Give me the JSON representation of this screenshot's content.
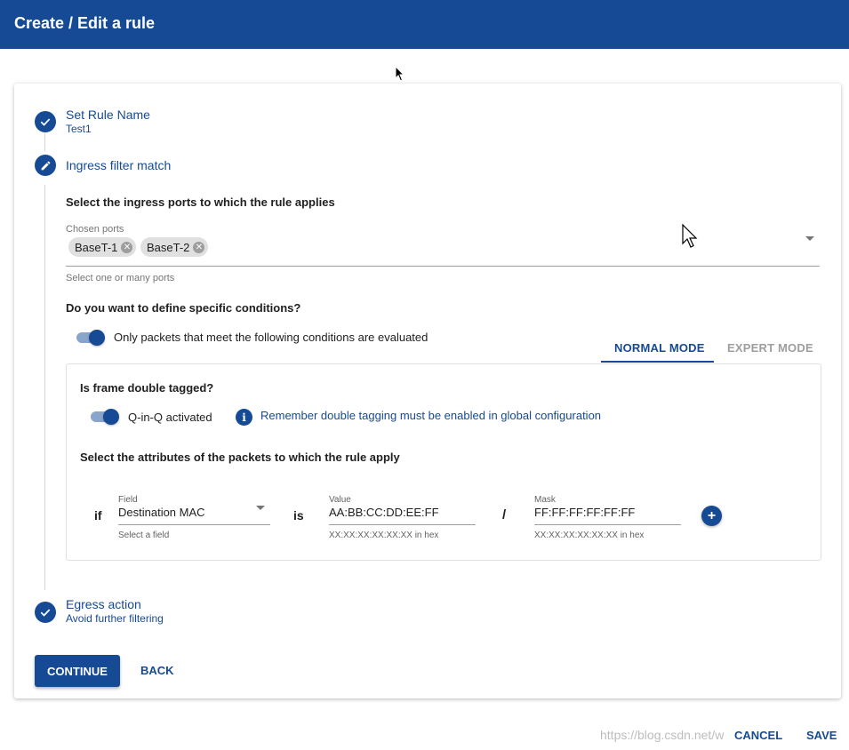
{
  "header": {
    "title": "Create / Edit a rule"
  },
  "steps": {
    "rule_name": {
      "title": "Set Rule Name",
      "value": "Test1"
    },
    "ingress": {
      "title": "Ingress filter match",
      "ports_heading": "Select the ingress ports to which the rule applies",
      "ports_label": "Chosen ports",
      "ports": [
        "BaseT-1",
        "BaseT-2"
      ],
      "ports_hint": "Select one or many ports",
      "conditions_heading": "Do you want to define specific conditions?",
      "conditions_toggle_label": "Only packets that meet the following conditions are evaluated",
      "tabs": [
        "NORMAL MODE",
        "EXPERT MODE"
      ],
      "double_tag_heading": "Is frame double tagged?",
      "qinq_label": "Q-in-Q activated",
      "info_text": "Remember double tagging must be enabled in global configuration",
      "attributes_heading": "Select the attributes of the packets to which the rule apply",
      "condition": {
        "if_label": "if",
        "field_label": "Field",
        "field_value": "Destination MAC",
        "field_hint": "Select a field",
        "is_label": "is",
        "value_label": "Value",
        "value": "AA:BB:CC:DD:EE:FF",
        "value_hint": "XX:XX:XX:XX:XX:XX in hex",
        "slash": "/",
        "mask_label": "Mask",
        "mask": "FF:FF:FF:FF:FF:FF",
        "mask_hint": "XX:XX:XX:XX:XX:XX in hex",
        "add_symbol": "+"
      }
    },
    "egress": {
      "title": "Egress action",
      "value": "Avoid further filtering"
    }
  },
  "actions": {
    "continue": "CONTINUE",
    "back": "BACK",
    "cancel": "CANCEL",
    "save": "SAVE"
  },
  "watermark": "https://blog.csdn.net/w",
  "colors": {
    "primary": "#164a94",
    "disabled_tab": "#9e9e9e"
  },
  "icons": [
    "check-icon",
    "pencil-icon",
    "close-icon",
    "dropdown-arrow-icon",
    "info-icon",
    "add-icon",
    "mouse-pointer-icon"
  ]
}
